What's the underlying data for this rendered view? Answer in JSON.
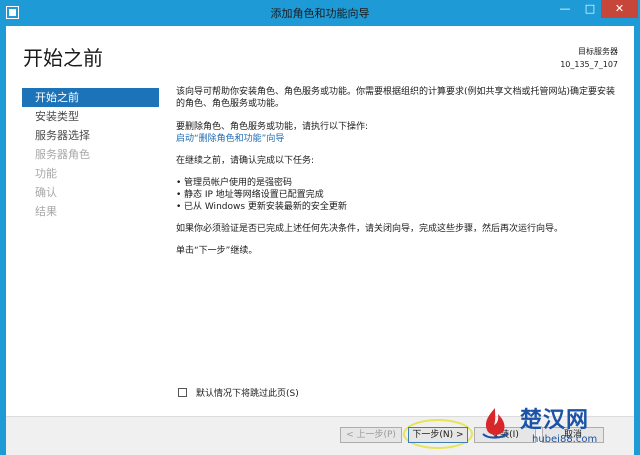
{
  "window": {
    "title": "添加角色和功能向导",
    "controls": {
      "minimize": "—",
      "maximize": "□",
      "close": "✕"
    }
  },
  "header": {
    "title": "开始之前",
    "target_label": "目标服务器",
    "target_server": "10_135_7_107"
  },
  "nav": {
    "items": [
      {
        "label": "开始之前",
        "state": "active"
      },
      {
        "label": "安装类型",
        "state": "enabled"
      },
      {
        "label": "服务器选择",
        "state": "enabled"
      },
      {
        "label": "服务器角色",
        "state": "disabled"
      },
      {
        "label": "功能",
        "state": "disabled"
      },
      {
        "label": "确认",
        "state": "disabled"
      },
      {
        "label": "结果",
        "state": "disabled"
      }
    ]
  },
  "content": {
    "intro": "该向导可帮助你安装角色、角色服务或功能。你需要根据组织的计算要求(例如共享文档或托管网站)确定要安装的角色、角色服务或功能。",
    "remove_intro": "要删除角色、角色服务或功能，请执行以下操作:",
    "remove_link": "启动“删除角色和功能”向导",
    "before_intro": "在继续之前，请确认完成以下任务:",
    "tasks": [
      "管理员帐户使用的是强密码",
      "静态 IP 地址等网络设置已配置完成",
      "已从 Windows 更新安装最新的安全更新"
    ],
    "close_note": "如果你必须验证是否已完成上述任何先决条件，请关闭向导，完成这些步骤，然后再次运行向导。",
    "continue_note": "单击“下一步”继续。"
  },
  "skip": {
    "label": "默认情况下将跳过此页(S)"
  },
  "buttons": {
    "prev": "< 上一步(P)",
    "next": "下一步(N) >",
    "install": "安装(I)",
    "cancel": "取消"
  },
  "watermark": {
    "name": "楚汉网",
    "url": "hubei88.com"
  },
  "colors": {
    "frame": "#1e9bd7",
    "accent": "#1d73b8",
    "link": "#1c6bb3",
    "close": "#c7463a",
    "highlight": "#e8e35a"
  }
}
